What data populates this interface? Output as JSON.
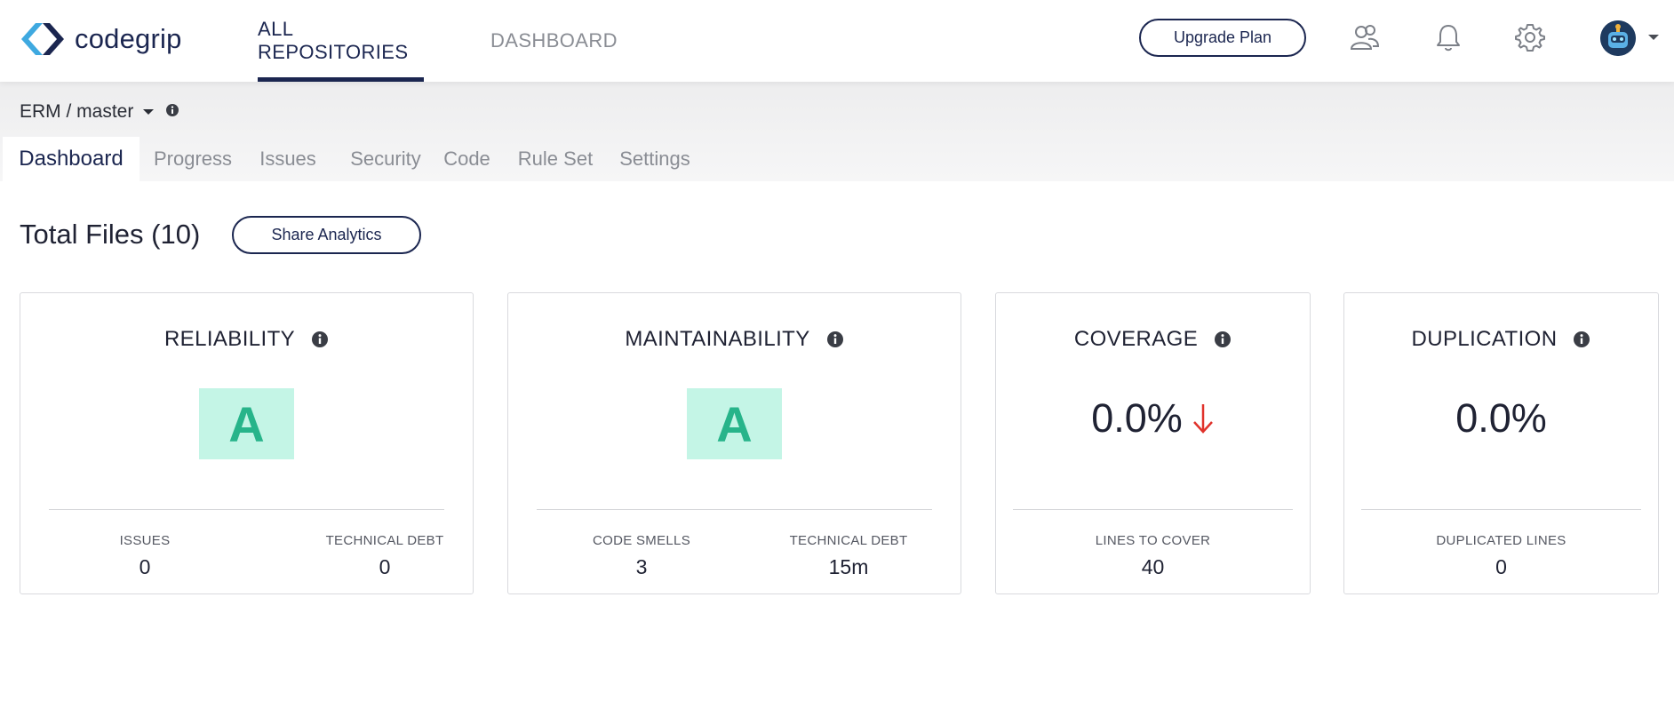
{
  "app": {
    "logo_text": "codegrip"
  },
  "topnav": {
    "tabs": [
      {
        "label": "ALL REPOSITORIES",
        "active": true
      },
      {
        "label": "DASHBOARD",
        "active": false
      }
    ],
    "upgrade_label": "Upgrade Plan",
    "icons": [
      "users-icon",
      "bell-icon",
      "gear-icon",
      "avatar",
      "caret-down-icon"
    ]
  },
  "repo": {
    "label": "ERM / master"
  },
  "subtabs": [
    {
      "label": "Dashboard",
      "active": true
    },
    {
      "label": "Progress"
    },
    {
      "label": "Issues"
    },
    {
      "label": "Security"
    },
    {
      "label": "Code"
    },
    {
      "label": "Rule Set"
    },
    {
      "label": "Settings"
    }
  ],
  "summary": {
    "total_files": "Total Files (10)",
    "share_label": "Share Analytics"
  },
  "cards": {
    "reliability": {
      "title": "RELIABILITY",
      "grade": "A",
      "metrics": [
        {
          "label": "ISSUES",
          "value": "0"
        },
        {
          "label": "TECHNICAL DEBT",
          "value": "0"
        }
      ]
    },
    "maintainability": {
      "title": "MAINTAINABILITY",
      "grade": "A",
      "metrics": [
        {
          "label": "CODE SMELLS",
          "value": "3"
        },
        {
          "label": "TECHNICAL DEBT",
          "value": "15m"
        }
      ]
    },
    "coverage": {
      "title": "COVERAGE",
      "value": "0.0%",
      "trend": "down",
      "metrics": [
        {
          "label": "LINES TO COVER",
          "value": "40"
        }
      ]
    },
    "duplication": {
      "title": "DUPLICATION",
      "value": "0.0%",
      "metrics": [
        {
          "label": "DUPLICATED LINES",
          "value": "0"
        }
      ]
    }
  },
  "colors": {
    "brand_navy": "#1b2650",
    "brand_blue": "#3fa9e0",
    "grade_bg": "#c4f5e6",
    "grade_text": "#27b48a",
    "trend_down": "#e0322b"
  }
}
